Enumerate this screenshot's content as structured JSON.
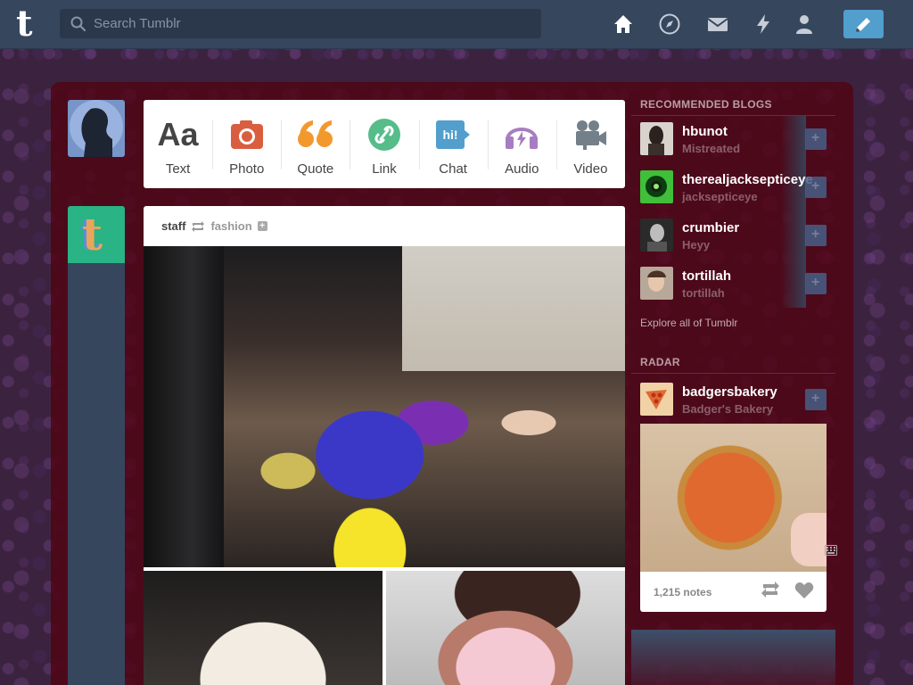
{
  "header": {
    "logo": "t",
    "search_placeholder": "Search Tumblr",
    "nav": [
      "home-icon",
      "explore-icon",
      "inbox-icon",
      "activity-icon",
      "account-icon"
    ],
    "compose_icon": "pencil-icon",
    "bg_color": "#36465d",
    "compose_color": "#529ecc"
  },
  "post_types": [
    {
      "label": "Text",
      "icon": "text-icon",
      "color": "#444444"
    },
    {
      "label": "Photo",
      "icon": "camera-icon",
      "color": "#d95e40"
    },
    {
      "label": "Quote",
      "icon": "quote-icon",
      "color": "#f2992e"
    },
    {
      "label": "Link",
      "icon": "link-icon",
      "color": "#56bc8a"
    },
    {
      "label": "Chat",
      "icon": "chat-icon",
      "color": "#529ecc"
    },
    {
      "label": "Audio",
      "icon": "headphones-icon",
      "color": "#a77dc2"
    },
    {
      "label": "Video",
      "icon": "video-camera-icon",
      "color": "#748089"
    }
  ],
  "post": {
    "author": "staff",
    "reblogged_from": "fashion"
  },
  "sidebar": {
    "recommended_title": "RECOMMENDED BLOGS",
    "blogs": [
      {
        "name": "hbunot",
        "title": "Mistreated",
        "avatar_color": "#d9d3cd"
      },
      {
        "name": "therealjacksepticeye",
        "title": "jacksepticeye",
        "avatar_color": "#3fbf3a"
      },
      {
        "name": "crumbier",
        "title": "Heyy",
        "avatar_color": "#2a2a2a"
      },
      {
        "name": "tortillah",
        "title": "tortillah",
        "avatar_color": "#b7a89a"
      }
    ],
    "explore_link": "Explore all of Tumblr",
    "radar_title": "RADAR",
    "radar": {
      "name": "badgersbakery",
      "title": "Badger's Bakery",
      "notes": "1,215 notes",
      "avatar_color": "#f0d2a6"
    }
  }
}
